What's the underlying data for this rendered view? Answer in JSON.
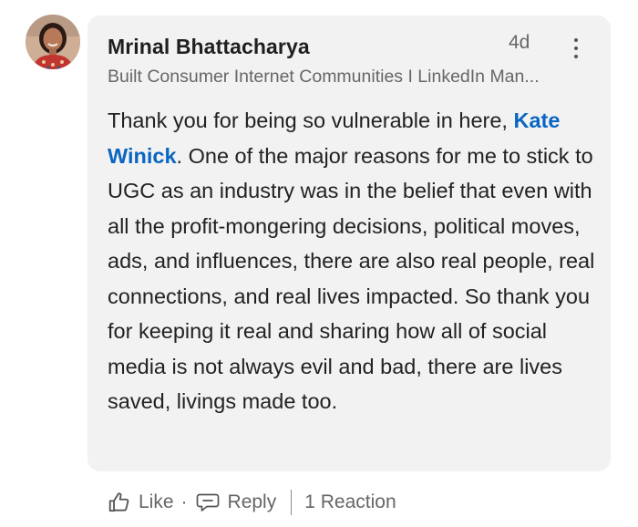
{
  "comment": {
    "author_name": "Mrinal Bhattacharya",
    "timestamp": "4d",
    "headline": "Built Consumer Internet Communities I LinkedIn Man...",
    "body_before": "Thank you for being so vulnerable in here, ",
    "mention": "Kate Winick",
    "body_after": ". One of the major reasons for me to stick to UGC as an industry was in the belief that even with all the profit-mongering decisions, political moves, ads, and influences, there are also real people, real connections, and real lives impacted. So thank you for keeping it real and sharing how all of social media is not always evil and bad, there are lives saved, livings made too."
  },
  "actions": {
    "like_label": "Like",
    "separator": "·",
    "reply_label": "Reply",
    "reactions_label": "1 Reaction"
  },
  "icons": {
    "like": "thumbs-up-icon",
    "reply": "comment-icon",
    "more": "more-vertical-icon"
  },
  "colors": {
    "mention": "#0a66c2",
    "bubble": "#f2f2f2",
    "muted_text": "#666666"
  }
}
